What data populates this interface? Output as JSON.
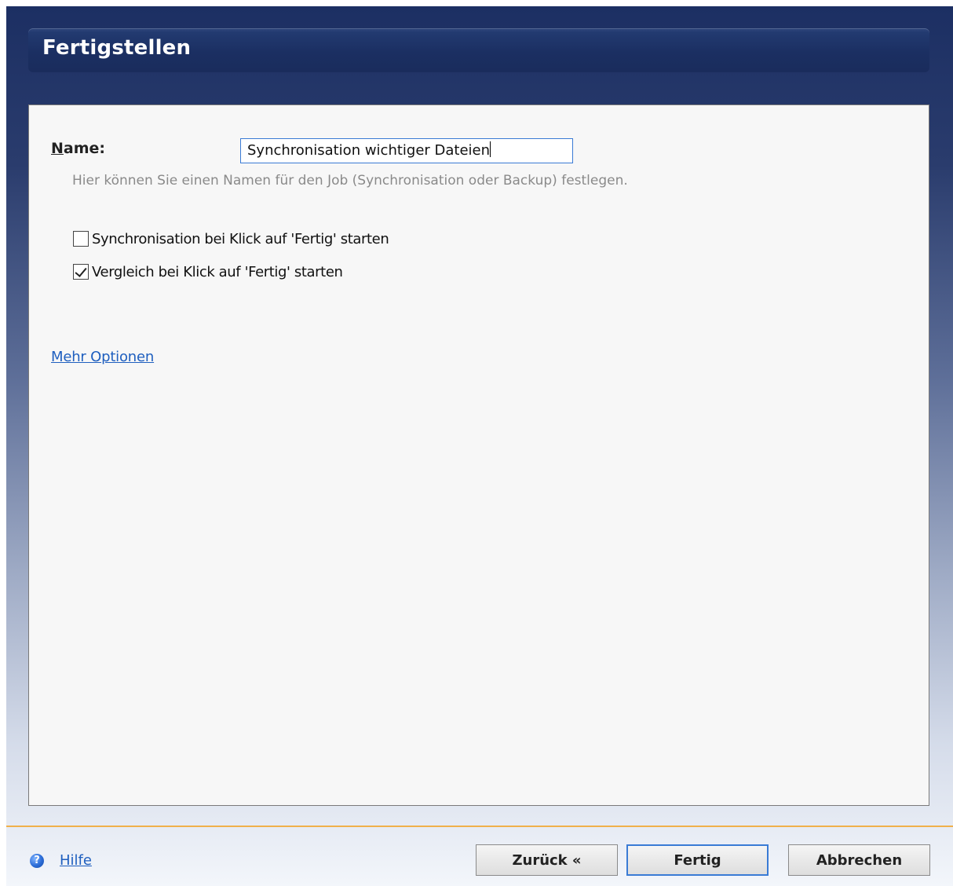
{
  "header": {
    "title": "Fertigstellen"
  },
  "form": {
    "name_label_first": "N",
    "name_label_rest": "ame:",
    "name_value": "Synchronisation wichtiger Dateien",
    "hint": "Hier können Sie einen Namen für den  Job (Synchronisation oder Backup) festlegen."
  },
  "options": [
    {
      "label": "Synchronisation bei Klick auf 'Fertig' starten",
      "checked": false
    },
    {
      "label": "Vergleich bei Klick auf 'Fertig' starten",
      "checked": true
    }
  ],
  "more_options_label": "Mehr Optionen",
  "footer": {
    "help_icon": "help-icon",
    "help_label": "Hilfe",
    "back_label": "Zurück «",
    "finish_label": "Fertig",
    "cancel_label": "Abbrechen"
  },
  "colors": {
    "header_bg": "#1b2f62",
    "link": "#1f5fbf",
    "accent_line": "#f0b04a",
    "focus_border": "#3a7bd5"
  }
}
